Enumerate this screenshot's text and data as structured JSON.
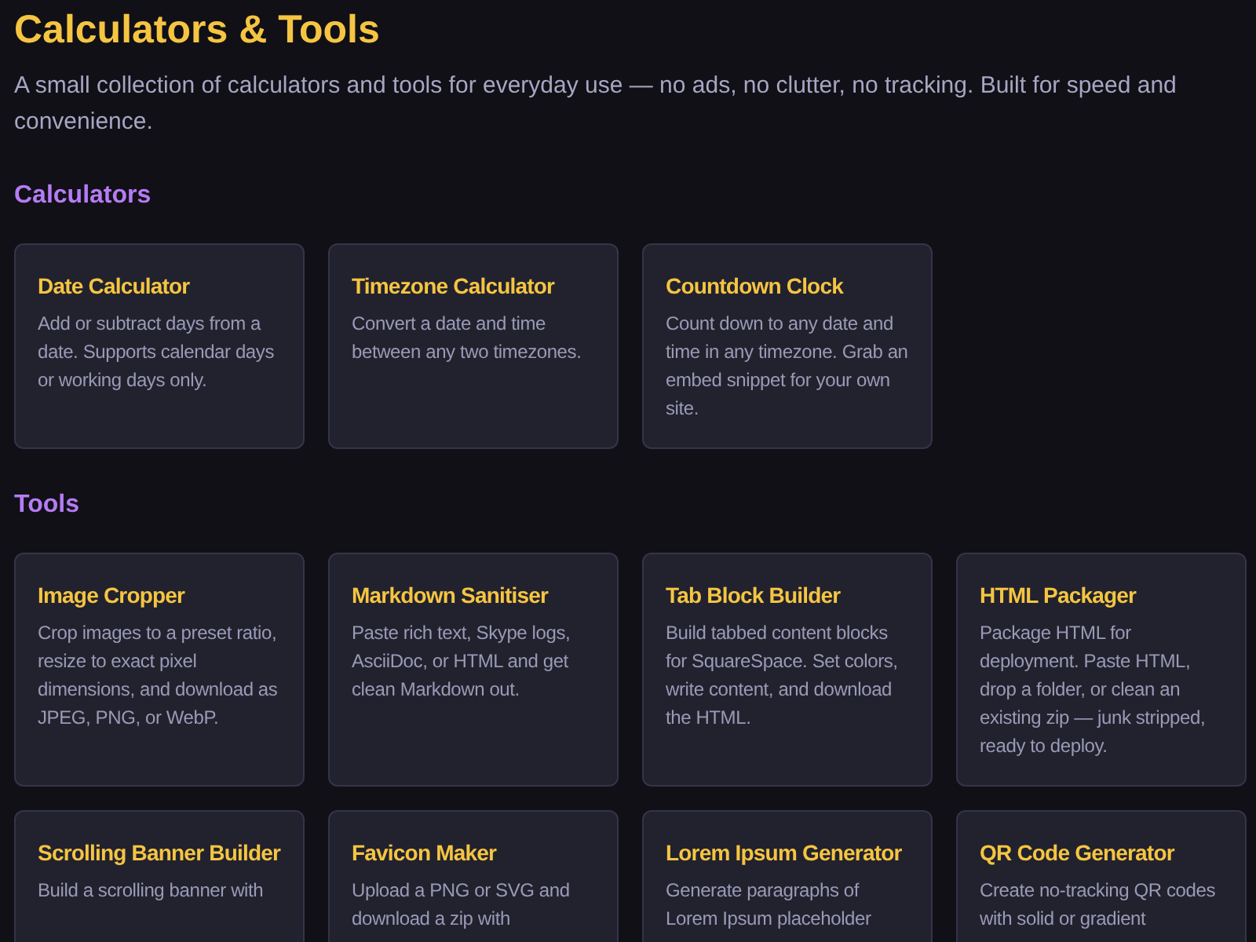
{
  "title": "Calculators & Tools",
  "intro": "A small collection of calculators and tools for everyday use — no ads, no clutter, no tracking. Built for speed and convenience.",
  "sections": [
    {
      "heading": "Calculators",
      "cards": [
        {
          "title": "Date Calculator",
          "description": "Add or subtract days from a date. Supports calendar days or working days only."
        },
        {
          "title": "Timezone Calculator",
          "description": "Convert a date and time between any two timezones."
        },
        {
          "title": "Countdown Clock",
          "description": "Count down to any date and time in any timezone. Grab an embed snippet for your own site."
        }
      ]
    },
    {
      "heading": "Tools",
      "cards": [
        {
          "title": "Image Cropper",
          "description": "Crop images to a preset ratio, resize to exact pixel dimensions, and download as JPEG, PNG, or WebP."
        },
        {
          "title": "Markdown Sanitiser",
          "description": "Paste rich text, Skype logs, AsciiDoc, or HTML and get clean Markdown out."
        },
        {
          "title": "Tab Block Builder",
          "description": "Build tabbed content blocks for SquareSpace. Set colors, write content, and download the HTML."
        },
        {
          "title": "HTML Packager",
          "description": "Package HTML for deployment. Paste HTML, drop a folder, or clean an existing zip — junk stripped, ready to deploy."
        },
        {
          "title": "Scrolling Banner Builder",
          "description": "Build a scrolling banner with"
        },
        {
          "title": "Favicon Maker",
          "description": "Upload a PNG or SVG and download a zip with"
        },
        {
          "title": "Lorem Ipsum Generator",
          "description": "Generate paragraphs of Lorem Ipsum placeholder"
        },
        {
          "title": "QR Code Generator",
          "description": "Create no-tracking QR codes with solid or gradient"
        }
      ]
    }
  ]
}
